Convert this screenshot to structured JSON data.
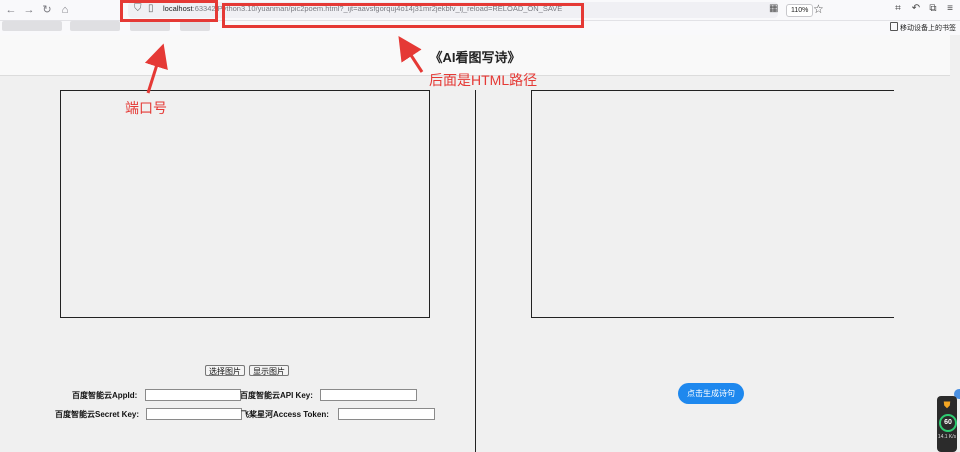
{
  "browser": {
    "url_host": "localhost",
    "url_rest": ":63342/Python3.10/yuanman/pic2poem.html?_ijt=aavsfgorquj4o14j31mr2jekbfv_ij_reload=RELOAD_ON_SAVE",
    "zoom": "110%",
    "bookmarks_label": "移动设备上的书签"
  },
  "page": {
    "title": "《AI看图写诗》",
    "select_image_label": "选择图片",
    "show_image_label": "显示图片",
    "generate_label": "点击生成诗句"
  },
  "form": {
    "appid_label": "百度智能云AppId:",
    "apikey_label": "百度智能云API Key:",
    "secretkey_label": "百度智能云Secret Key:",
    "access_token_label": "飞桨星河Access Token:",
    "appid_value": "",
    "apikey_value": "",
    "secretkey_value": "",
    "access_token_value": ""
  },
  "annotations": {
    "port_label": "端口号",
    "path_label": "后面是HTML路径"
  },
  "widget": {
    "score": "60",
    "speed": "14.1 K/s"
  },
  "colors": {
    "annotation_red": "#e53935",
    "button_blue": "#1e88ee",
    "widget_green": "#2ecc71"
  }
}
